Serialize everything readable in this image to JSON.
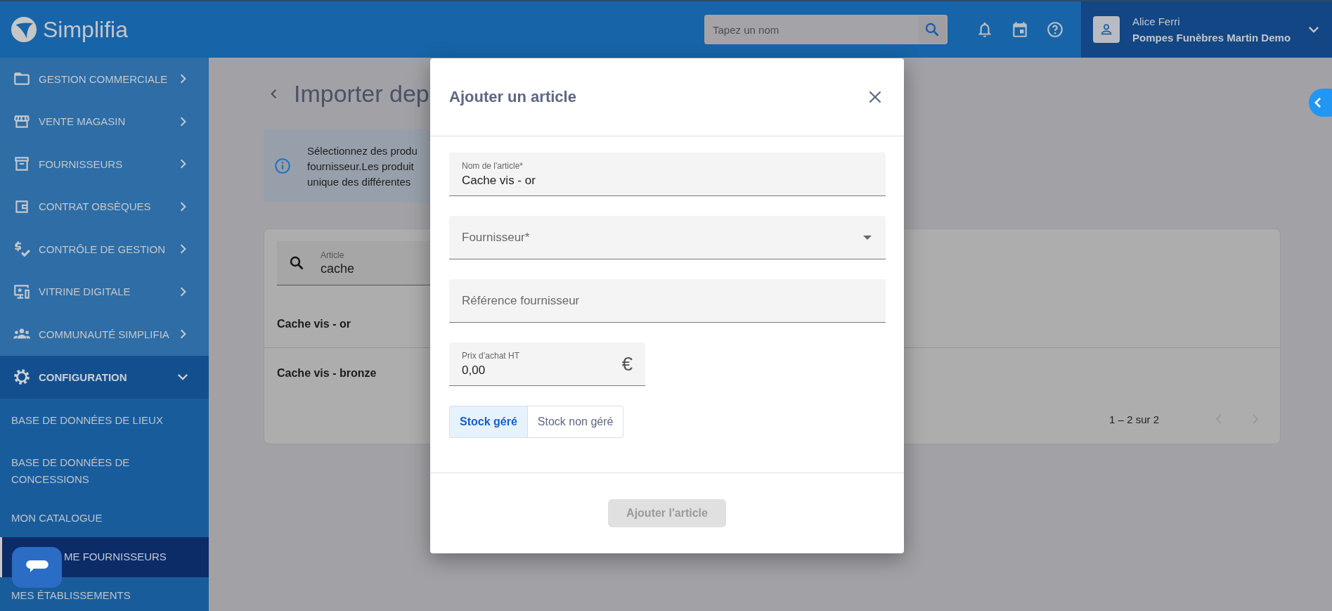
{
  "header": {
    "logo_text": "Simplifia",
    "search": {
      "placeholder": "Tapez un nom"
    },
    "user": {
      "name": "Alice Ferri",
      "company": "Pompes Funèbres Martin Demo"
    }
  },
  "sidebar": {
    "items": [
      {
        "label": "GESTION COMMERCIALE",
        "expanded": false
      },
      {
        "label": "VENTE MAGASIN",
        "expanded": false
      },
      {
        "label": "FOURNISSEURS",
        "expanded": false
      },
      {
        "label": "CONTRAT OBSÈQUES",
        "expanded": false
      },
      {
        "label": "CONTRÔLE DE GESTION",
        "expanded": false
      },
      {
        "label": "VITRINE DIGITALE",
        "expanded": false
      },
      {
        "label": "COMMUNAUTÉ SIMPLIFIA",
        "expanded": false
      },
      {
        "label": "CONFIGURATION",
        "expanded": true,
        "children": [
          {
            "label": "BASE DE DONNÉES DE LIEUX",
            "selected": false
          },
          {
            "label": "BASE DE DONNÉES DE CONCESSIONS",
            "selected": false
          },
          {
            "label": "MON CATALOGUE",
            "selected": false
          },
          {
            "label": "ME FOURNISSEURS",
            "selected": true
          },
          {
            "label": "MES ÉTABLISSEMENTS",
            "selected": false
          }
        ]
      }
    ]
  },
  "page": {
    "title": "Importer dep",
    "info_lines": [
      "Sélectionnez des produ",
      "fournisseur.Les produit",
      "unique des différentes"
    ],
    "search": {
      "label": "Article",
      "value": "cache"
    },
    "rows": [
      "Cache vis - or",
      "Cache vis - bronze"
    ],
    "pagination": "1 – 2 sur 2"
  },
  "dialog": {
    "title": "Ajouter un article",
    "fields": [
      {
        "kind": "text",
        "label": "Nom de l'article*",
        "value": "Cache vis - or"
      },
      {
        "kind": "select",
        "label": "Fournisseur*"
      },
      {
        "kind": "text",
        "label": "Référence fournisseur"
      },
      {
        "kind": "text",
        "label": "Prix d’achat HT",
        "value": "0,00",
        "suffix": "€"
      }
    ],
    "stock_options": [
      {
        "label": "Stock géré",
        "selected": true
      },
      {
        "label": "Stock non géré",
        "selected": false
      }
    ],
    "submit": {
      "label": "Ajouter l'article",
      "disabled": true
    }
  }
}
